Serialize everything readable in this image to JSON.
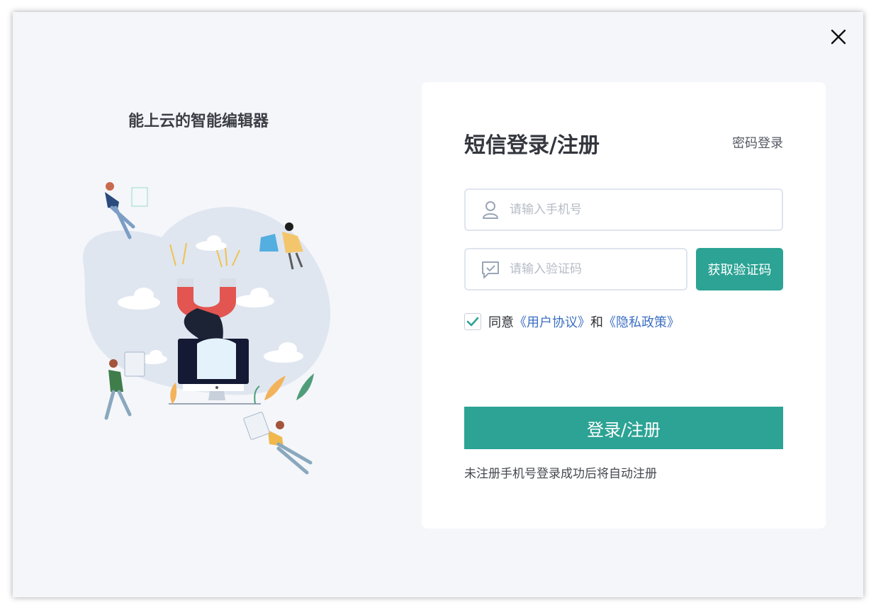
{
  "left": {
    "tagline": "能上云的智能编辑器"
  },
  "login": {
    "title": "短信登录/注册",
    "password_login_link": "密码登录",
    "phone_placeholder": "请输入手机号",
    "code_placeholder": "请输入验证码",
    "get_code_label": "获取验证码",
    "agree_prefix": "同意",
    "user_agreement": "《用户协议》",
    "and": "和",
    "privacy_policy": "《隐私政策》",
    "agree_checked": true,
    "submit_label": "登录/注册",
    "note": "未注册手机号登录成功后将自动注册"
  },
  "colors": {
    "accent": "#2ca394",
    "link": "#3c6fc3"
  },
  "icons": {
    "close": "close-icon",
    "user": "user-icon",
    "message": "message-check-icon",
    "check": "check-icon"
  }
}
